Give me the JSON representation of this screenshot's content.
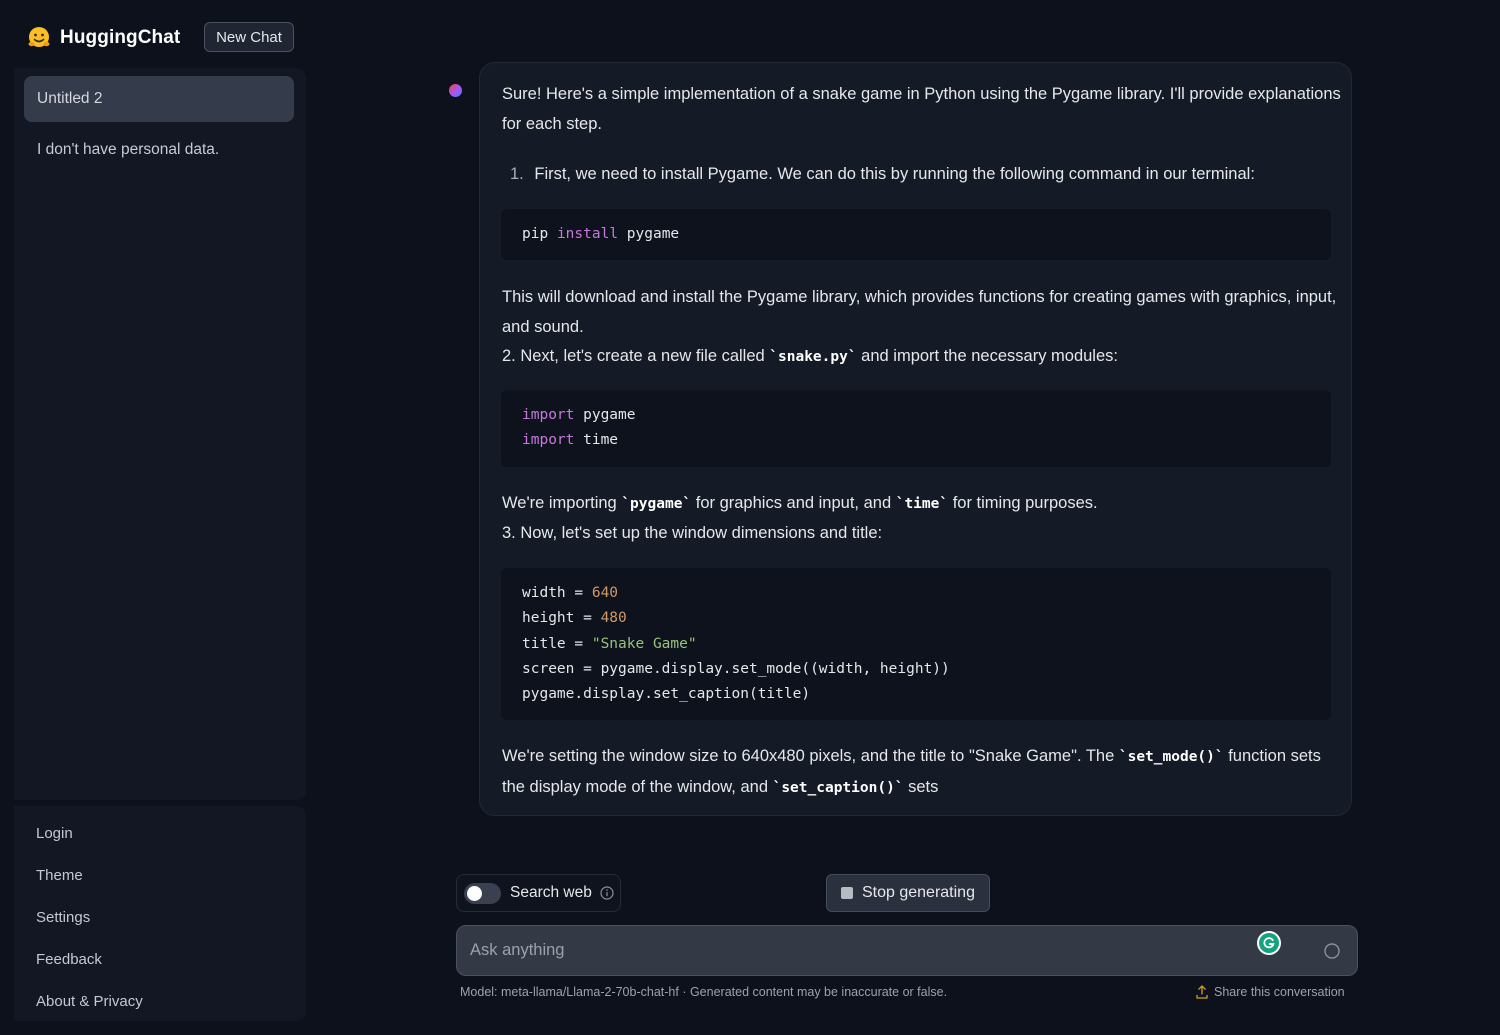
{
  "app": {
    "brand": "HuggingChat",
    "new_chat_label": "New Chat"
  },
  "sidebar": {
    "conversations": [
      {
        "label": "Untitled 2",
        "active": true
      },
      {
        "label": "I don't have personal data.",
        "active": false
      }
    ],
    "nav": [
      {
        "label": "Login"
      },
      {
        "label": "Theme"
      },
      {
        "label": "Settings"
      },
      {
        "label": "Feedback"
      },
      {
        "label": "About & Privacy"
      }
    ]
  },
  "message": {
    "intro": "Sure! Here's a simple implementation of a snake game in Python using the Pygame library. I'll provide explanations for each step.",
    "step1_number": "1.",
    "step1_text": "First, we need to install Pygame. We can do this by running the following command in our terminal:",
    "code1": [
      "pip",
      "install",
      "pygame"
    ],
    "after_code1": "This will download and install the Pygame library, which provides functions for creating games with graphics, input, and sound.",
    "step2_before": "2. Next, let's create a new file called ",
    "step2_code": "`snake.py`",
    "step2_after": " and import the necessary modules:",
    "code2": [
      {
        "kw": "import",
        "rest": " pygame"
      },
      {
        "kw": "import",
        "rest": " time"
      }
    ],
    "importing_a": "We're importing ",
    "importing_code1": "`pygame`",
    "importing_b": " for graphics and input, and ",
    "importing_code2": "`time`",
    "importing_c": " for timing purposes.",
    "step3_text": "3. Now, let's set up the window dimensions and title:",
    "code3": {
      "width_line": "width = ",
      "width_val": "640",
      "height_line": "height = ",
      "height_val": "480",
      "title_line": "title = ",
      "title_val": "\"Snake Game\"",
      "screen_line": "screen = pygame.display.set_mode((width, height))",
      "caption_line": "pygame.display.set_caption(title)"
    },
    "final_a": "We're setting the window size to 640x480 pixels, and the title to \"Snake Game\". The ",
    "final_code1": "`set_mode()`",
    "final_b": " function sets the display mode of the window, and ",
    "final_code2": "`set_caption()`",
    "final_c": " sets"
  },
  "controls": {
    "search_web_label": "Search web",
    "search_web_enabled": false,
    "stop_label": "Stop generating",
    "input_placeholder": "Ask anything",
    "footer_model": "Model: meta-llama/Llama-2-70b-chat-hf · Generated content may be inaccurate or false.",
    "share_label": "Share this conversation"
  },
  "icons": {
    "logo": "hugging-face-logo-icon",
    "info": "info-icon",
    "stop": "stop-square-icon",
    "grammarly": "grammarly-icon",
    "send": "loading-circle-icon",
    "share": "share-upload-icon"
  },
  "colors": {
    "background": "#0d111b",
    "bubble": "#141a26",
    "keyword": "#c678dd",
    "number": "#d19a66",
    "string": "#98c379",
    "grammarly": "#15a37f"
  }
}
